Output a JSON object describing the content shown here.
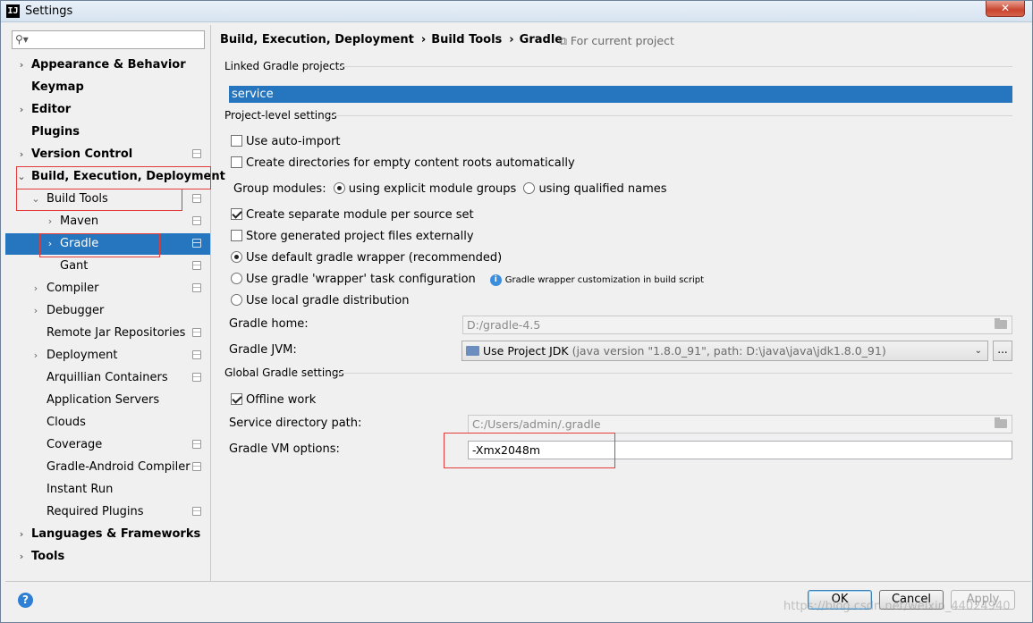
{
  "window": {
    "title": "Settings",
    "close_glyph": "✕",
    "app_icon_text": "IJ"
  },
  "search": {
    "placeholder": "",
    "icon": "search-icon"
  },
  "tree": [
    {
      "label": "Appearance & Behavior",
      "level": 0,
      "bold": true,
      "arrow": "›",
      "shared": false
    },
    {
      "label": "Keymap",
      "level": 0,
      "bold": true,
      "arrow": "",
      "shared": false
    },
    {
      "label": "Editor",
      "level": 0,
      "bold": true,
      "arrow": "›",
      "shared": false
    },
    {
      "label": "Plugins",
      "level": 0,
      "bold": true,
      "arrow": "",
      "shared": false
    },
    {
      "label": "Version Control",
      "level": 0,
      "bold": true,
      "arrow": "›",
      "shared": true
    },
    {
      "label": "Build, Execution, Deployment",
      "level": 0,
      "bold": true,
      "arrow": "⌄",
      "shared": false
    },
    {
      "label": "Build Tools",
      "level": 1,
      "bold": false,
      "arrow": "⌄",
      "shared": true
    },
    {
      "label": "Maven",
      "level": 2,
      "bold": false,
      "arrow": "›",
      "shared": true
    },
    {
      "label": "Gradle",
      "level": 2,
      "bold": false,
      "arrow": "›",
      "shared": true,
      "selected": true
    },
    {
      "label": "Gant",
      "level": 2,
      "bold": false,
      "arrow": "",
      "shared": true
    },
    {
      "label": "Compiler",
      "level": 1,
      "bold": false,
      "arrow": "›",
      "shared": true
    },
    {
      "label": "Debugger",
      "level": 1,
      "bold": false,
      "arrow": "›",
      "shared": false
    },
    {
      "label": "Remote Jar Repositories",
      "level": 1,
      "bold": false,
      "arrow": "",
      "shared": true
    },
    {
      "label": "Deployment",
      "level": 1,
      "bold": false,
      "arrow": "›",
      "shared": true
    },
    {
      "label": "Arquillian Containers",
      "level": 1,
      "bold": false,
      "arrow": "",
      "shared": true
    },
    {
      "label": "Application Servers",
      "level": 1,
      "bold": false,
      "arrow": "",
      "shared": false
    },
    {
      "label": "Clouds",
      "level": 1,
      "bold": false,
      "arrow": "",
      "shared": false
    },
    {
      "label": "Coverage",
      "level": 1,
      "bold": false,
      "arrow": "",
      "shared": true
    },
    {
      "label": "Gradle-Android Compiler",
      "level": 1,
      "bold": false,
      "arrow": "",
      "shared": true
    },
    {
      "label": "Instant Run",
      "level": 1,
      "bold": false,
      "arrow": "",
      "shared": false
    },
    {
      "label": "Required Plugins",
      "level": 1,
      "bold": false,
      "arrow": "",
      "shared": true
    },
    {
      "label": "Languages & Frameworks",
      "level": 0,
      "bold": true,
      "arrow": "›",
      "shared": false
    },
    {
      "label": "Tools",
      "level": 0,
      "bold": true,
      "arrow": "›",
      "shared": false
    }
  ],
  "breadcrumb": {
    "items": [
      "Build, Execution, Deployment",
      "Build Tools",
      "Gradle"
    ],
    "separator": "›",
    "scope": "For current project"
  },
  "sections": {
    "linked": "Linked Gradle projects",
    "project_level": "Project-level settings",
    "global": "Global Gradle settings"
  },
  "linked_projects": [
    "service"
  ],
  "options": {
    "auto_import": {
      "label": "Use auto-import",
      "checked": false
    },
    "create_dirs": {
      "label": "Create directories for empty content roots automatically",
      "checked": false
    },
    "group_modules": {
      "label": "Group modules:",
      "explicit": {
        "label": "using explicit module groups",
        "checked": true
      },
      "qualified": {
        "label": "using qualified names",
        "checked": false
      }
    },
    "separate_module": {
      "label": "Create separate module per source set",
      "checked": true
    },
    "store_external": {
      "label": "Store generated project files externally",
      "checked": false
    },
    "default_wrapper": {
      "label": "Use default gradle wrapper (recommended)",
      "checked": true
    },
    "wrapper_task": {
      "label": "Use gradle 'wrapper' task configuration",
      "checked": false
    },
    "wrapper_hint": "Gradle wrapper customization in build script",
    "local_dist": {
      "label": "Use local gradle distribution",
      "checked": false
    },
    "offline": {
      "label": "Offline work",
      "checked": true
    }
  },
  "fields": {
    "gradle_home": {
      "label": "Gradle home:",
      "value": "D:/gradle-4.5"
    },
    "gradle_jvm": {
      "label": "Gradle JVM:",
      "value": "Use Project JDK",
      "detail": "(java version \"1.8.0_91\", path: D:\\java\\java\\jdk1.8.0_91)"
    },
    "service_dir": {
      "label": "Service directory path:",
      "value": "C:/Users/admin/.gradle"
    },
    "vm_options": {
      "label": "Gradle VM options:",
      "value": "-Xmx2048m"
    }
  },
  "buttons": {
    "ok": "OK",
    "cancel": "Cancel",
    "apply": "Apply",
    "help": "?",
    "more": "..."
  },
  "watermark": "https://blog.csdn.net/weixin_44024940"
}
